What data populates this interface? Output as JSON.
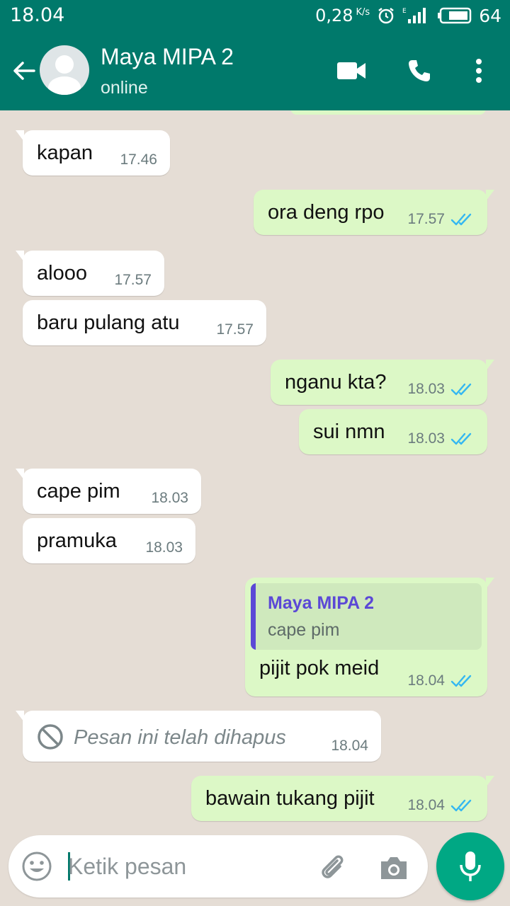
{
  "status_bar": {
    "time": "18.04",
    "speed": "0,28",
    "speed_unit": "K/s",
    "battery": "64"
  },
  "header": {
    "contact_name": "Maya MIPA 2",
    "contact_status": "online"
  },
  "messages": [
    {
      "direction": "in",
      "text": "kapan",
      "time": "17.46"
    },
    {
      "direction": "out",
      "text": "ora deng rpo",
      "time": "17.57",
      "read": true
    },
    {
      "direction": "in",
      "text": "alooo",
      "time": "17.57"
    },
    {
      "direction": "in",
      "text": "baru pulang atu",
      "time": "17.57"
    },
    {
      "direction": "out",
      "text": "nganu kta?",
      "time": "18.03",
      "read": true
    },
    {
      "direction": "out",
      "text": "sui nmn",
      "time": "18.03",
      "read": true
    },
    {
      "direction": "in",
      "text": "cape pim",
      "time": "18.03"
    },
    {
      "direction": "in",
      "text": "pramuka",
      "time": "18.03"
    },
    {
      "direction": "out",
      "text": "pijit pok meid",
      "time": "18.04",
      "read": true,
      "quote": {
        "name": "Maya MIPA 2",
        "text": "cape pim"
      }
    },
    {
      "direction": "in",
      "deleted": true,
      "text": "Pesan ini telah dihapus",
      "time": "18.04"
    },
    {
      "direction": "out",
      "text": "bawain tukang pijit",
      "time": "18.04",
      "read": true
    }
  ],
  "composer": {
    "placeholder": "Ketik pesan"
  },
  "colors": {
    "header": "#00796b",
    "incoming": "#ffffff",
    "outgoing": "#dcf8c6",
    "read_ticks": "#34b7f1",
    "quote_accent": "#5b48d6",
    "mic_button": "#00a884",
    "chat_background": "#e5ddd5"
  },
  "icons": [
    "back-arrow-icon",
    "avatar-icon",
    "video-call-icon",
    "phone-icon",
    "more-vert-icon",
    "emoji-icon",
    "attach-icon",
    "camera-icon",
    "mic-icon",
    "blocked-icon",
    "double-check-icon",
    "alarm-icon",
    "signal-icon",
    "battery-icon"
  ]
}
